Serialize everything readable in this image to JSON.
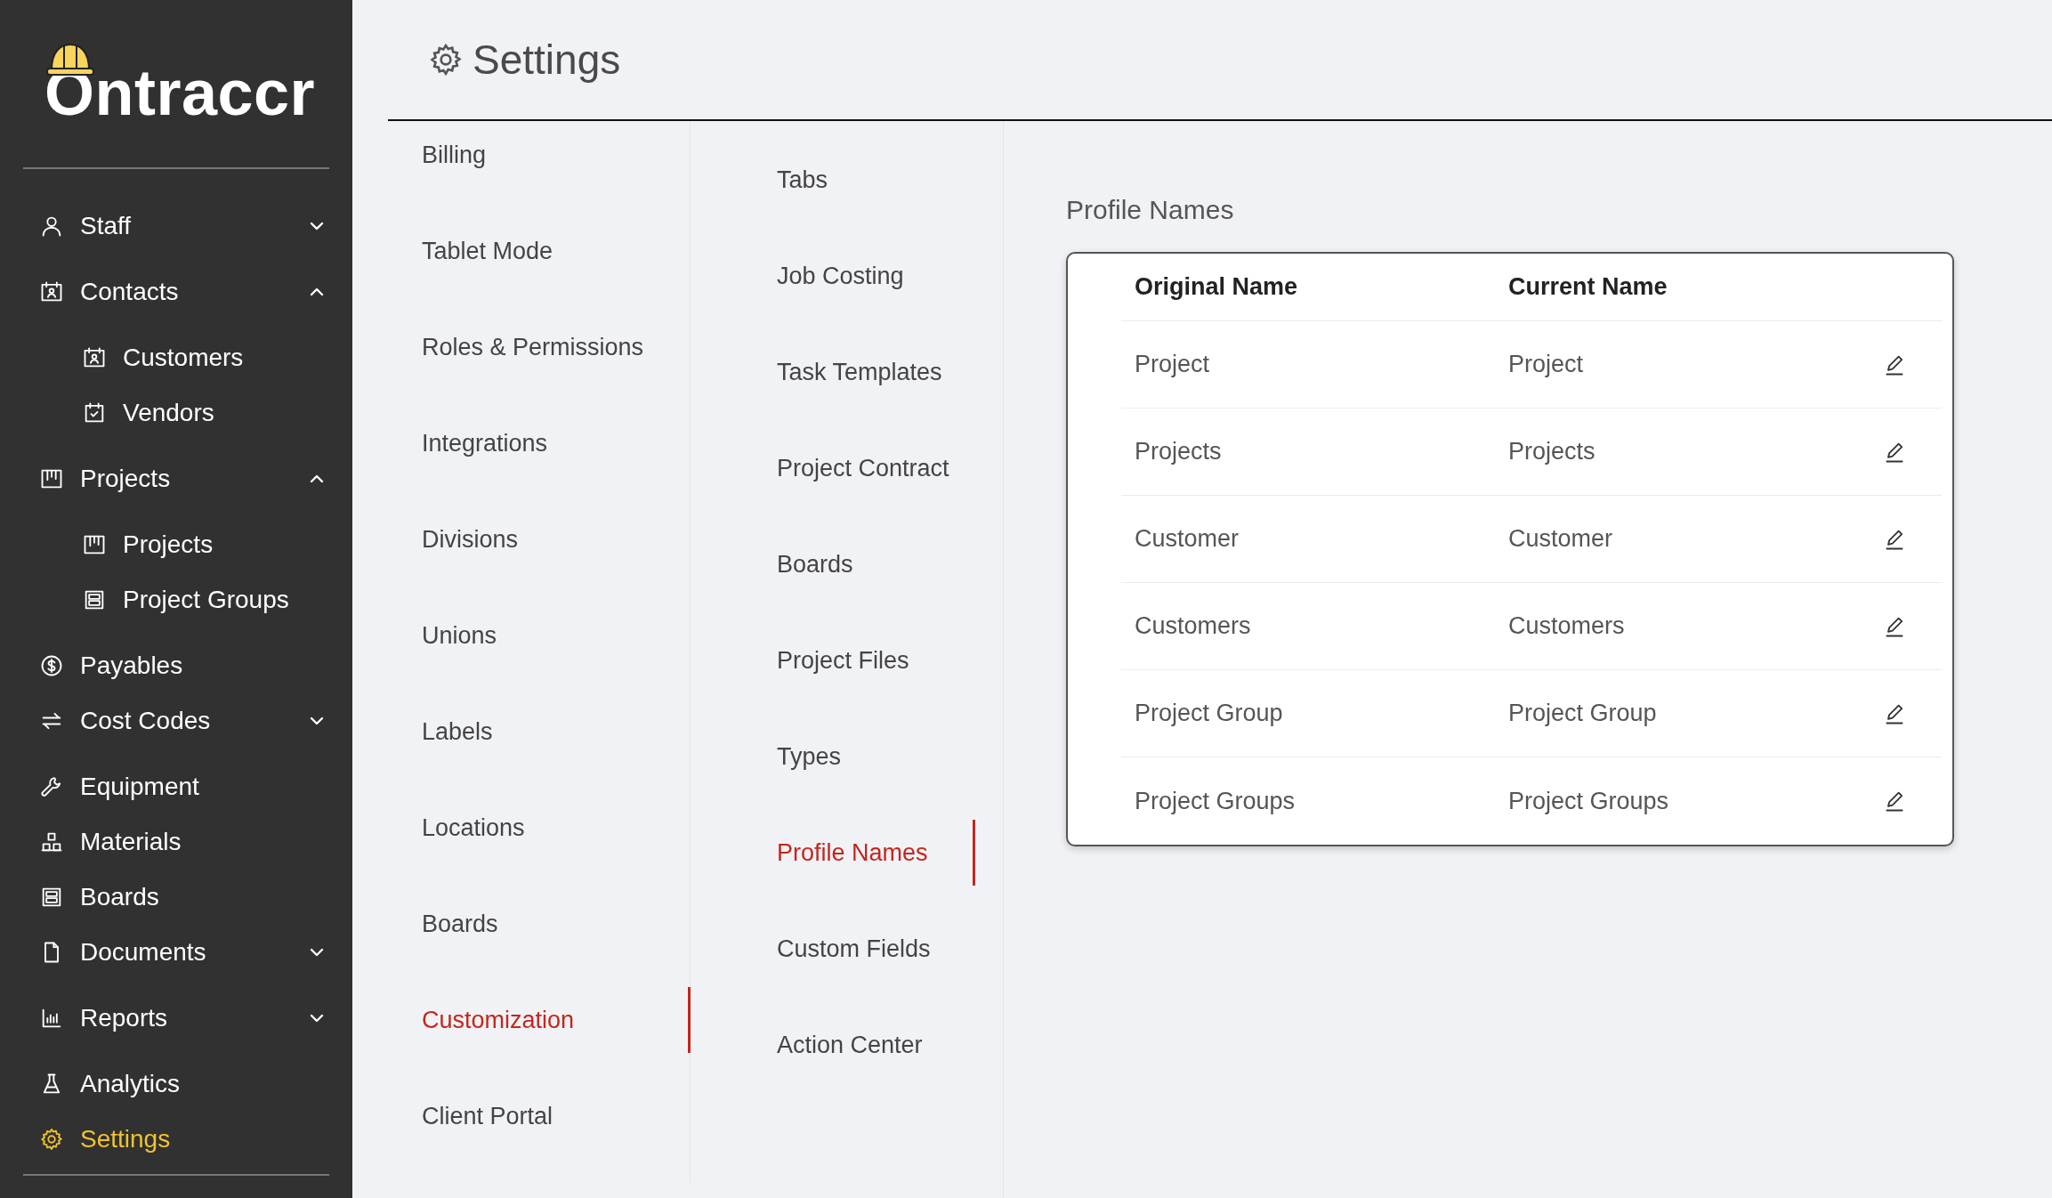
{
  "logo": {
    "text": "Ontraccr"
  },
  "sidebar": {
    "items": [
      {
        "label": "Staff",
        "expanded": false,
        "selected": false
      },
      {
        "label": "Contacts",
        "expanded": true,
        "selected": false,
        "children": [
          {
            "label": "Customers",
            "selected": false
          },
          {
            "label": "Vendors",
            "selected": false
          }
        ]
      },
      {
        "label": "Projects",
        "expanded": true,
        "selected": false,
        "children": [
          {
            "label": "Projects",
            "selected": false
          },
          {
            "label": "Project Groups",
            "selected": false
          }
        ]
      },
      {
        "label": "Payables",
        "selected": false
      },
      {
        "label": "Cost Codes",
        "expanded": false,
        "selected": false
      },
      {
        "label": "Equipment",
        "selected": false
      },
      {
        "label": "Materials",
        "selected": false
      },
      {
        "label": "Boards",
        "selected": false
      },
      {
        "label": "Documents",
        "expanded": false,
        "selected": false
      },
      {
        "label": "Reports",
        "expanded": false,
        "selected": false
      },
      {
        "label": "Analytics",
        "selected": false
      },
      {
        "label": "Settings",
        "selected": true
      }
    ]
  },
  "header": {
    "title": "Settings"
  },
  "settings_nav": {
    "items": [
      {
        "label": "Billing",
        "selected": false
      },
      {
        "label": "Tablet Mode",
        "selected": false
      },
      {
        "label": "Roles & Permissions",
        "selected": false
      },
      {
        "label": "Integrations",
        "selected": false
      },
      {
        "label": "Divisions",
        "selected": false
      },
      {
        "label": "Unions",
        "selected": false
      },
      {
        "label": "Labels",
        "selected": false
      },
      {
        "label": "Locations",
        "selected": false
      },
      {
        "label": "Boards",
        "selected": false
      },
      {
        "label": "Customization",
        "selected": true
      },
      {
        "label": "Client Portal",
        "selected": false
      }
    ]
  },
  "customization_nav": {
    "items": [
      {
        "label": "Tabs",
        "selected": false
      },
      {
        "label": "Job Costing",
        "selected": false
      },
      {
        "label": "Task Templates",
        "selected": false
      },
      {
        "label": "Project Contract",
        "selected": false
      },
      {
        "label": "Boards",
        "selected": false
      },
      {
        "label": "Project Files",
        "selected": false
      },
      {
        "label": "Types",
        "selected": false
      },
      {
        "label": "Profile Names",
        "selected": true
      },
      {
        "label": "Custom Fields",
        "selected": false
      },
      {
        "label": "Action Center",
        "selected": false
      }
    ]
  },
  "content": {
    "heading": "Profile Names",
    "table": {
      "columns": [
        "Original Name",
        "Current Name"
      ],
      "rows": [
        {
          "original_name": "Project",
          "current_name": "Project"
        },
        {
          "original_name": "Projects",
          "current_name": "Projects"
        },
        {
          "original_name": "Customer",
          "current_name": "Customer"
        },
        {
          "original_name": "Customers",
          "current_name": "Customers"
        },
        {
          "original_name": "Project Group",
          "current_name": "Project Group"
        },
        {
          "original_name": "Project Groups",
          "current_name": "Project Groups"
        }
      ]
    }
  }
}
